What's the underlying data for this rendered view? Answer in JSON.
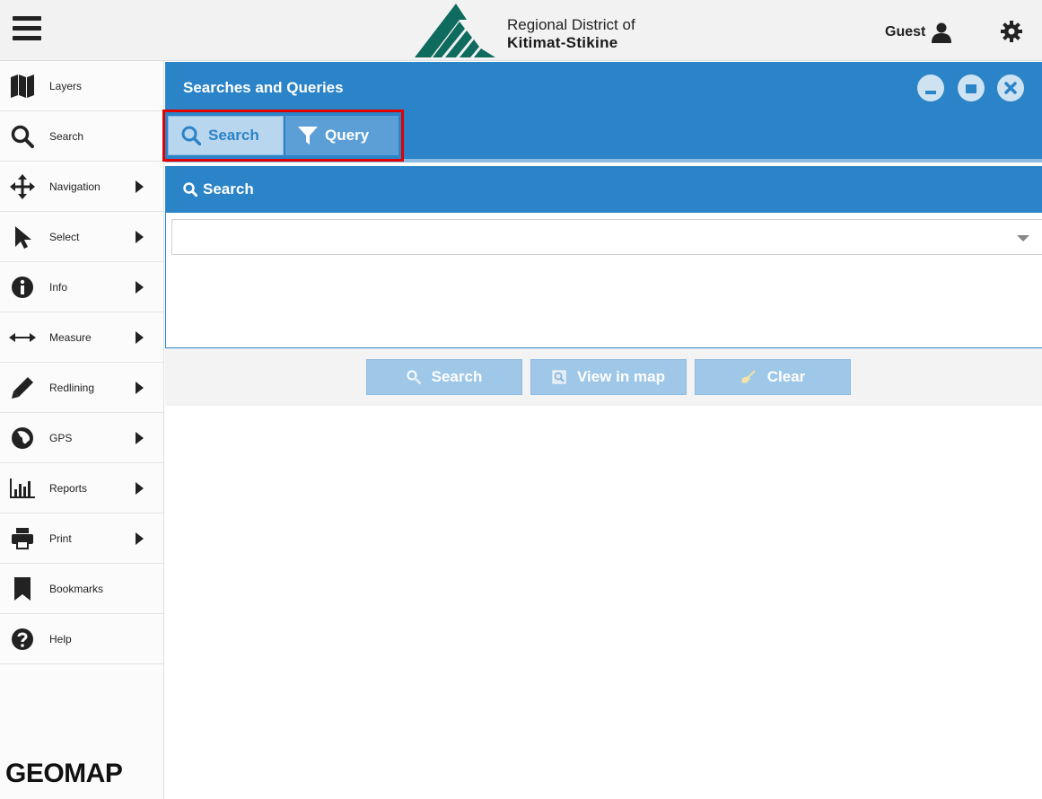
{
  "header": {
    "org_line1": "Regional District of",
    "org_line2": "Kitimat-Stikine",
    "user_name": "Guest",
    "menu_icon": "hamburger-icon",
    "settings_icon": "gear-icon"
  },
  "sidebar": {
    "items": [
      {
        "label": "Layers",
        "icon": "map-icon",
        "has_submenu": false
      },
      {
        "label": "Search",
        "icon": "search-icon",
        "has_submenu": false
      },
      {
        "label": "Navigation",
        "icon": "move-arrows-icon",
        "has_submenu": true
      },
      {
        "label": "Select",
        "icon": "cursor-icon",
        "has_submenu": true
      },
      {
        "label": "Info",
        "icon": "info-icon",
        "has_submenu": true
      },
      {
        "label": "Measure",
        "icon": "measure-arrows-icon",
        "has_submenu": true
      },
      {
        "label": "Redlining",
        "icon": "pencil-icon",
        "has_submenu": true
      },
      {
        "label": "GPS",
        "icon": "globe-icon",
        "has_submenu": true
      },
      {
        "label": "Reports",
        "icon": "bar-chart-icon",
        "has_submenu": true
      },
      {
        "label": "Print",
        "icon": "printer-icon",
        "has_submenu": true
      },
      {
        "label": "Bookmarks",
        "icon": "bookmark-icon",
        "has_submenu": false
      },
      {
        "label": "Help",
        "icon": "help-icon",
        "has_submenu": false
      }
    ],
    "brand": "GEOMAP"
  },
  "panel": {
    "title": "Searches and Queries",
    "tabs": [
      {
        "label": "Search",
        "icon": "search-icon",
        "active": true
      },
      {
        "label": "Query",
        "icon": "filter-icon",
        "active": false
      }
    ],
    "section_title": "Search",
    "search_combo": {
      "value": "",
      "placeholder": ""
    },
    "buttons": {
      "search": "Search",
      "view_in_map": "View in map",
      "clear": "Clear"
    }
  },
  "colors": {
    "primary": "#2b83c8",
    "tab_active_bg": "#b9d6ef",
    "button_disabled": "#9ec7e8",
    "highlight": "#e00000"
  }
}
